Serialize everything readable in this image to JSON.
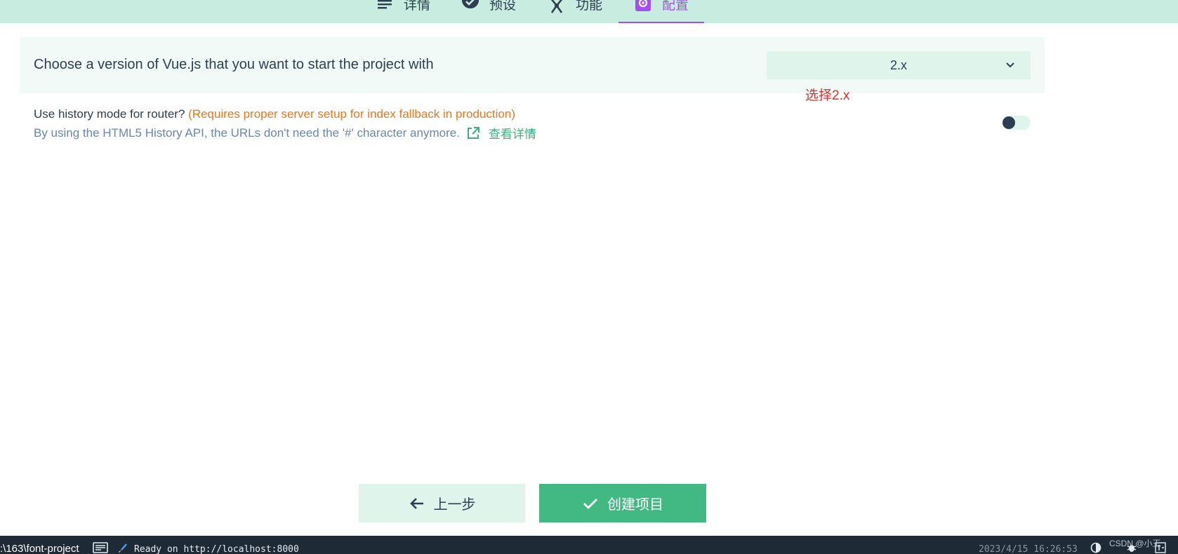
{
  "tabs": [
    {
      "label": "详情",
      "icon": "list-icon"
    },
    {
      "label": "预设",
      "icon": "check-circle-icon"
    },
    {
      "label": "功能",
      "icon": "fork-icon"
    },
    {
      "label": "配置",
      "icon": "gear-icon",
      "active": true
    }
  ],
  "prompt_version": {
    "question": "Choose a version of Vue.js that you want to start the project with",
    "selected": "2.x"
  },
  "annotation": "选择2.x",
  "prompt_history": {
    "question": "Use history mode for router?",
    "warning": "(Requires proper server setup for index fallback in production)",
    "description": "By using the HTML5 History API, the URLs don't need the '#' character anymore.",
    "link_label": "查看详情",
    "enabled": false
  },
  "buttons": {
    "prev_label": "上一步",
    "create_label": "创建项目"
  },
  "statusbar": {
    "path": ":\\163\\font-project",
    "ready": "Ready on http://localhost:8000",
    "time": "2023/4/15 16:26:53",
    "watermark": "CSDN @小王"
  },
  "colors": {
    "accent": "#42b883",
    "active_tab": "#a64cf5",
    "warning": "#e8761f",
    "annotation": "#e52e2e"
  }
}
